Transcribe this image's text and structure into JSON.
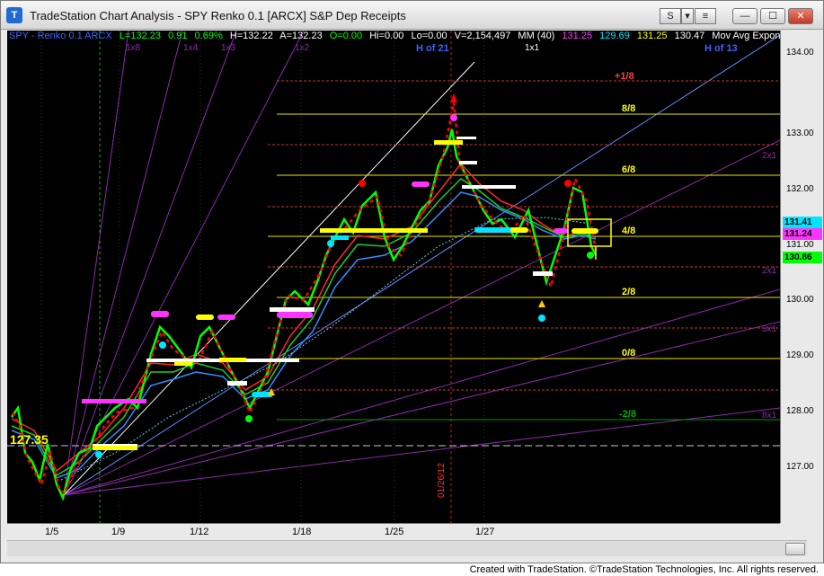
{
  "window": {
    "icon": "T",
    "title": "TradeStation Chart Analysis - SPY Renko 0.1 [ARCX] S&P Dep Receipts",
    "sym_button": "S",
    "arrow_button": "▾",
    "min": "—",
    "max": "☐",
    "close": "✕"
  },
  "info_bar": {
    "symbol": "SPY - Renko 0.1  ARCX",
    "last": "L=132.23",
    "change": "0.91",
    "pct": "0.69%",
    "high": "H=132.22",
    "ask": "A=132.23",
    "open": "O=0.00",
    "hi": "Hi=0.00",
    "lo": "Lo=0.00",
    "volume": "V=2,154,497",
    "ma_label": "MM (40)",
    "v1": "131.25",
    "v2": "129.69",
    "v3": "131.25",
    "v4": "130.47",
    "mov_avg": "Mov Avg Expone"
  },
  "chart_labels": {
    "h_of_21": "H of 21",
    "h_of_13": "H of 13",
    "fan_1x1": "1x1",
    "fan_1x2": "1x2",
    "fan_1x3": "1x3",
    "fan_1x4": "1x4",
    "fan_1x8": "1x8",
    "fan_2x1_a": "2x1",
    "fan_2x1_b": "2x1",
    "fan_3x1": "3x1",
    "fan_8x1": "8x1",
    "m_plus_1_8": "+1/8",
    "m_8_8": "8/8",
    "m_6_8": "6/8",
    "m_4_8": "4/8",
    "m_2_8": "2/8",
    "m_0_8": "0/8",
    "m_minus_2_8": "-2/8",
    "price_127_35": "127.35",
    "date_vertical": "01/26/12"
  },
  "price_axis": {
    "ticks": [
      "134.00",
      "133.00",
      "132.00",
      "131.00",
      "130.00",
      "129.00",
      "128.00",
      "127.00"
    ],
    "badge1": "131.41",
    "badge2": "131.24",
    "badge3": "130.86"
  },
  "date_axis": [
    "1/5",
    "1/9",
    "1/12",
    "1/18",
    "1/25",
    "1/27"
  ],
  "status": "Created with TradeStation. ©TradeStation Technologies, Inc. All rights reserved.",
  "colors": {
    "bull": "#00ff00",
    "bear": "#ff0000",
    "gann_fan": "#9a2fb0",
    "murrey_yellow": "#e6e600",
    "murrey_red": "#d23a2a",
    "label_blue": "#3c64ff"
  }
}
